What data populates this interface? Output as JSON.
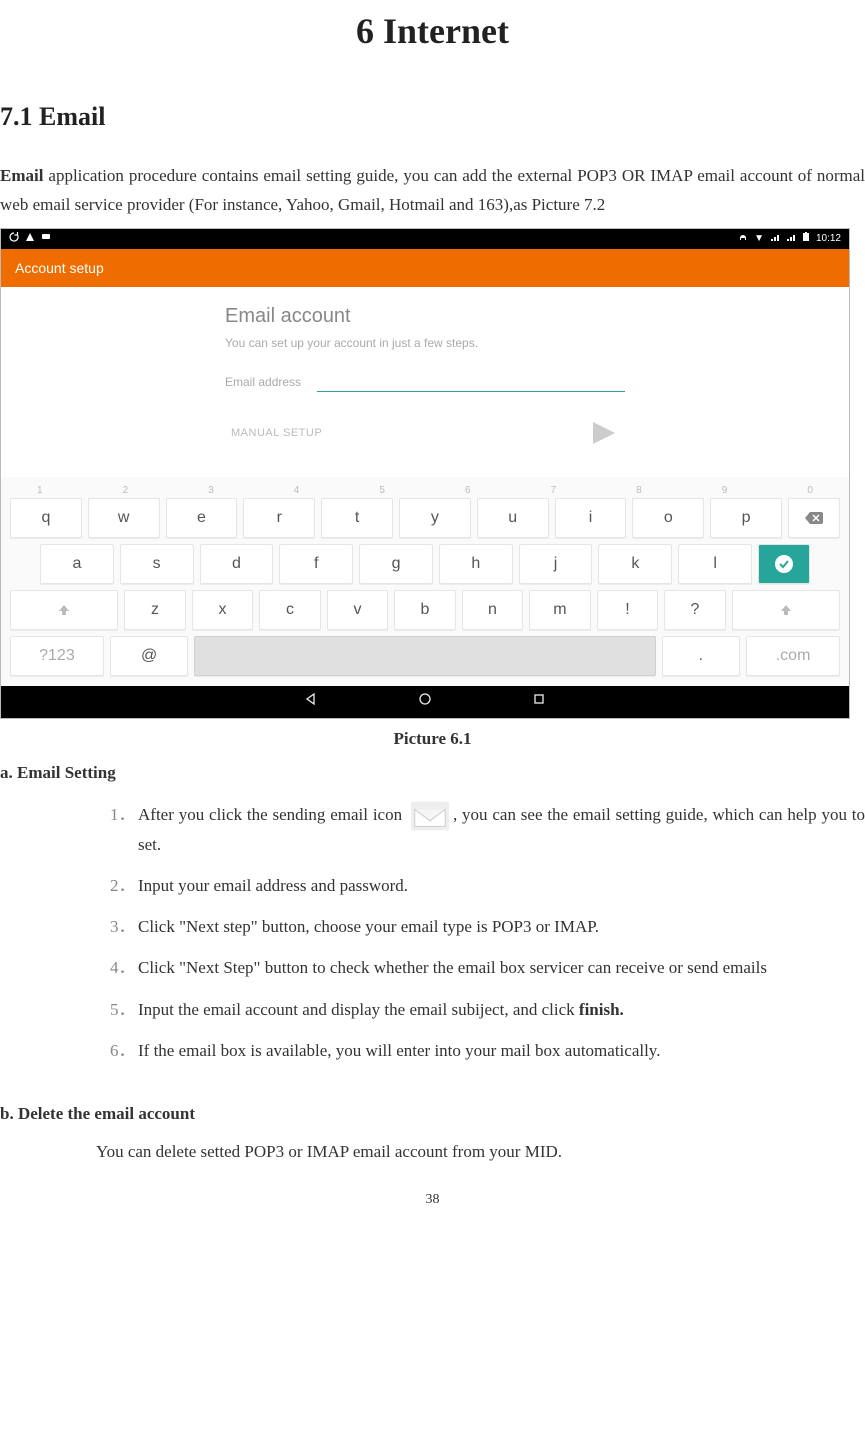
{
  "doc": {
    "chapter": "6 Internet",
    "section": "7.1 Email",
    "paragraph_prefix_bold": "Email",
    "paragraph_rest": " application procedure contains email setting guide, you can add the external POP3 OR IMAP email account of normal web email service provider (For instance, Yahoo, Gmail, Hotmail and 163),as Picture 7.2",
    "picture_caption": "Picture 6.1",
    "subhead_a": "a. Email Setting",
    "steps": [
      "After you click the sending email icon {ICON}, you can see the email setting guide, which can help you to set.",
      "Input your email address and password.",
      "Click \"Next step\" button, choose your email type is POP3 or IMAP.",
      "Click \"Next Step\" button to check whether the email box servicer can receive or send emails",
      "Input the email account and display the email subiject, and click finish.",
      "If the email box is available, you will enter into your mail box automatically."
    ],
    "step_bold_words": {
      "5": "finish."
    },
    "subhead_b": "b. Delete the email account",
    "delete_note": "You can delete setted POP3 or IMAP email account from your MID.",
    "page_number": "38"
  },
  "screenshot": {
    "status_time": "10:12",
    "app_bar_title": "Account setup",
    "form_title": "Email account",
    "form_sub": "You can set up your account in just a few steps.",
    "field_label": "Email address",
    "manual_setup": "MANUAL SETUP",
    "keyboard": {
      "nums": [
        "1",
        "2",
        "3",
        "4",
        "5",
        "6",
        "7",
        "8",
        "9",
        "0"
      ],
      "row1": [
        "q",
        "w",
        "e",
        "r",
        "t",
        "y",
        "u",
        "i",
        "o",
        "p"
      ],
      "row2": [
        "a",
        "s",
        "d",
        "f",
        "g",
        "h",
        "j",
        "k",
        "l"
      ],
      "row3": [
        "z",
        "x",
        "c",
        "v",
        "b",
        "n",
        "m",
        "!",
        "?"
      ],
      "bottom_left": "?123",
      "at": "@",
      "dot": ".",
      "dotcom": ".com"
    }
  }
}
